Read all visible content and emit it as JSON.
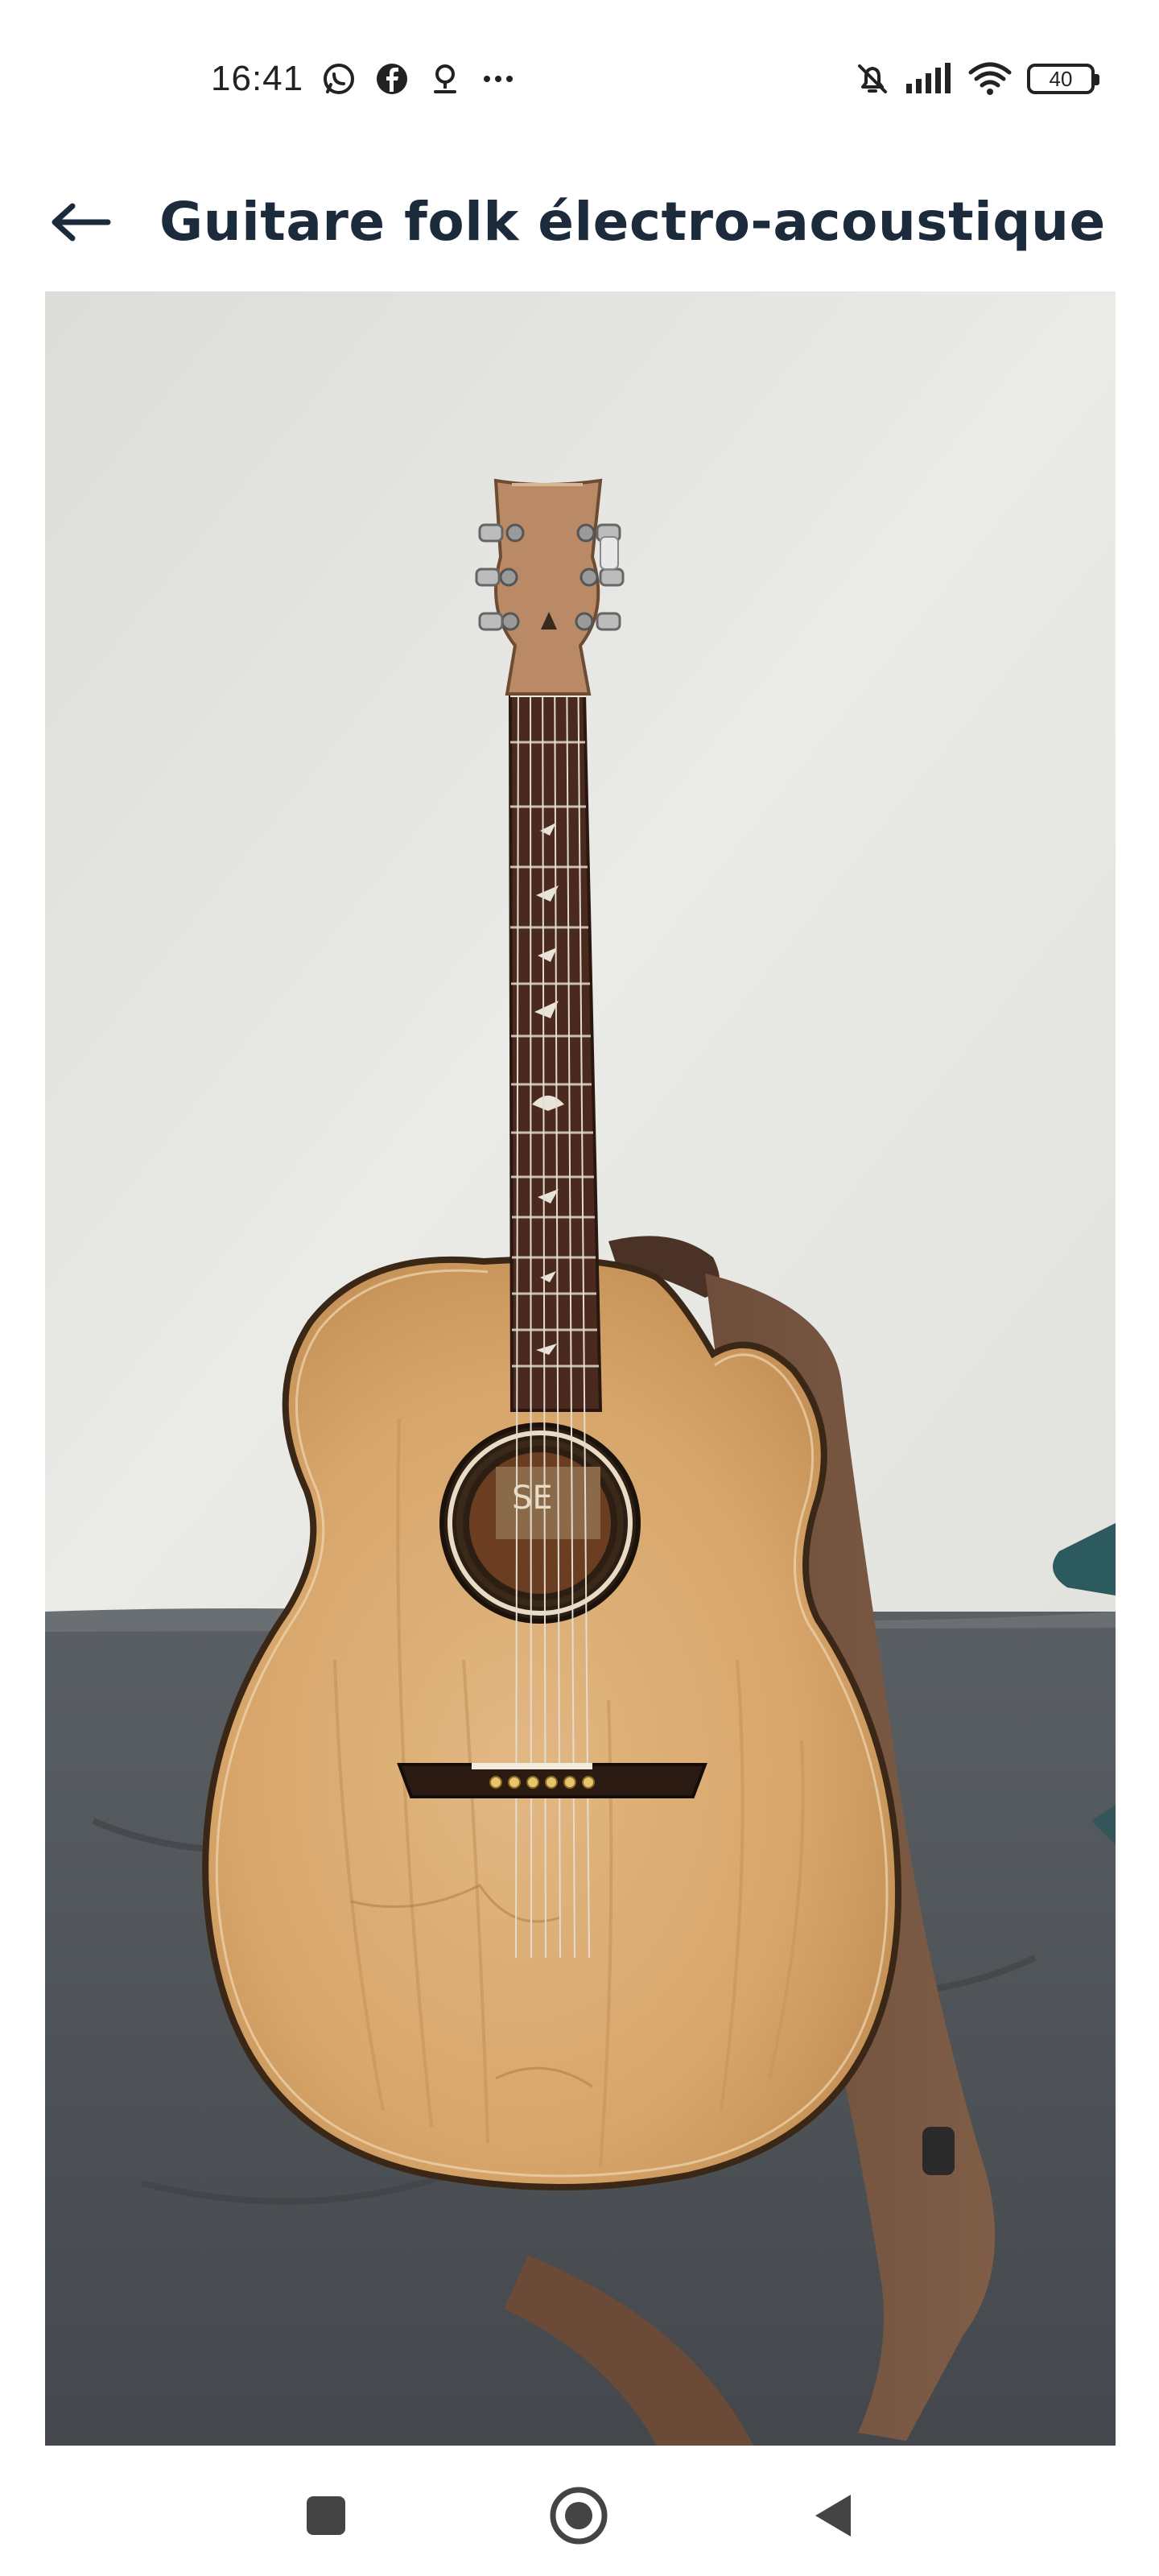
{
  "status_bar": {
    "time": "16:41",
    "notification_icons": [
      "whatsapp-icon",
      "facebook-icon",
      "location-pin-icon",
      "more-dots-icon"
    ],
    "system_icons": [
      "bell-muted-icon",
      "signal-icon",
      "wifi-icon",
      "battery-icon"
    ],
    "battery_level": "40"
  },
  "header": {
    "back_icon": "arrow-left-icon",
    "title": "Guitare folk électro-acoustique",
    "title_color": "#1c2b3c"
  },
  "photo": {
    "subject": "acoustic guitar with strap leaning against a wall on a grey sofa",
    "label_text": "SE"
  },
  "nav_bar": {
    "buttons": [
      "recents-square-icon",
      "home-circle-icon",
      "back-triangle-icon"
    ]
  }
}
